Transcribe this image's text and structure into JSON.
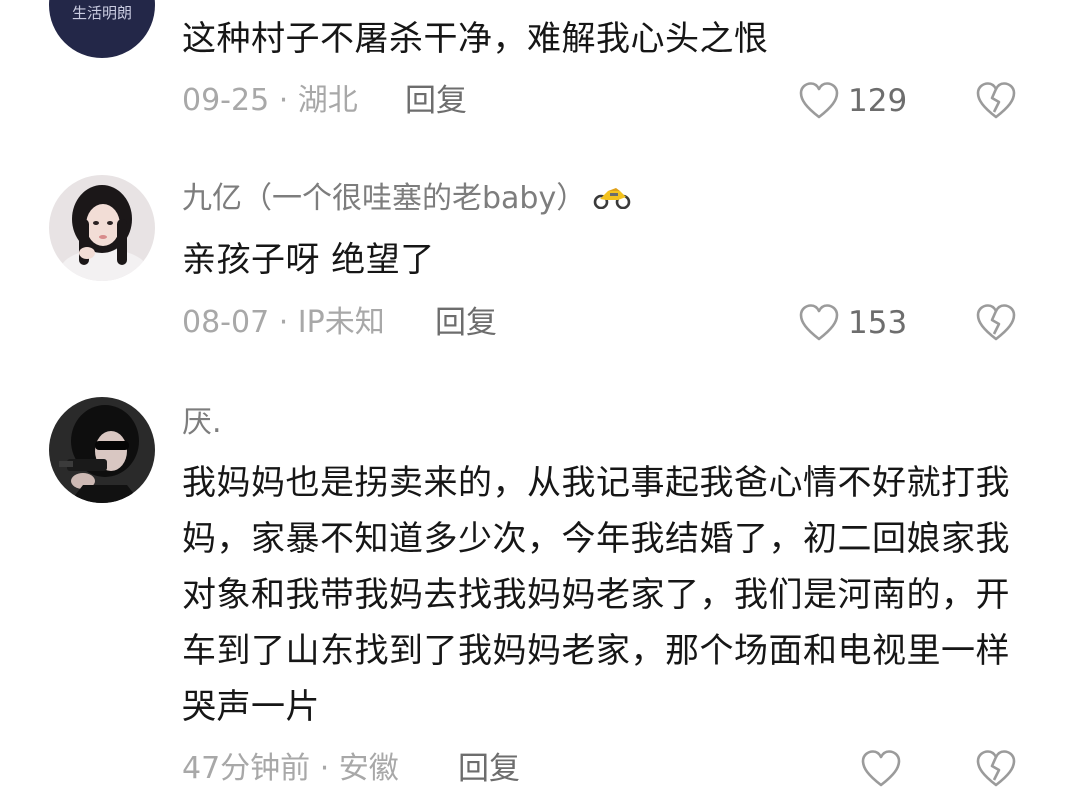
{
  "comments": [
    {
      "avatar_text": "生活明朗",
      "text": "这种村子不屠杀干净，难解我心头之恨",
      "date": "09-25",
      "location": "湖北",
      "reply_label": "回复",
      "likes": "129"
    },
    {
      "author": "九亿（一个很哇塞的老baby）",
      "badge_icon": "motorcycle-icon",
      "text": "亲孩子呀 绝望了",
      "date": "08-07",
      "location": "IP未知",
      "reply_label": "回复",
      "likes": "153"
    },
    {
      "author": "厌.",
      "text": "我妈妈也是拐卖来的，从我记事起我爸心情不好就打我妈，家暴不知道多少次，今年我结婚了，初二回娘家我对象和我带我妈去找我妈妈老家了，我们是河南的，开车到了山东找到了我妈妈老家，那个场面和电视里一样哭声一片",
      "date": "47分钟前",
      "location": "安徽",
      "reply_label": "回复",
      "likes": ""
    }
  ],
  "meta_separator": " · ",
  "colors": {
    "text": "#161616",
    "author": "#7d7d7d",
    "meta": "#a8a8a8",
    "action": "#6d6d6d"
  }
}
